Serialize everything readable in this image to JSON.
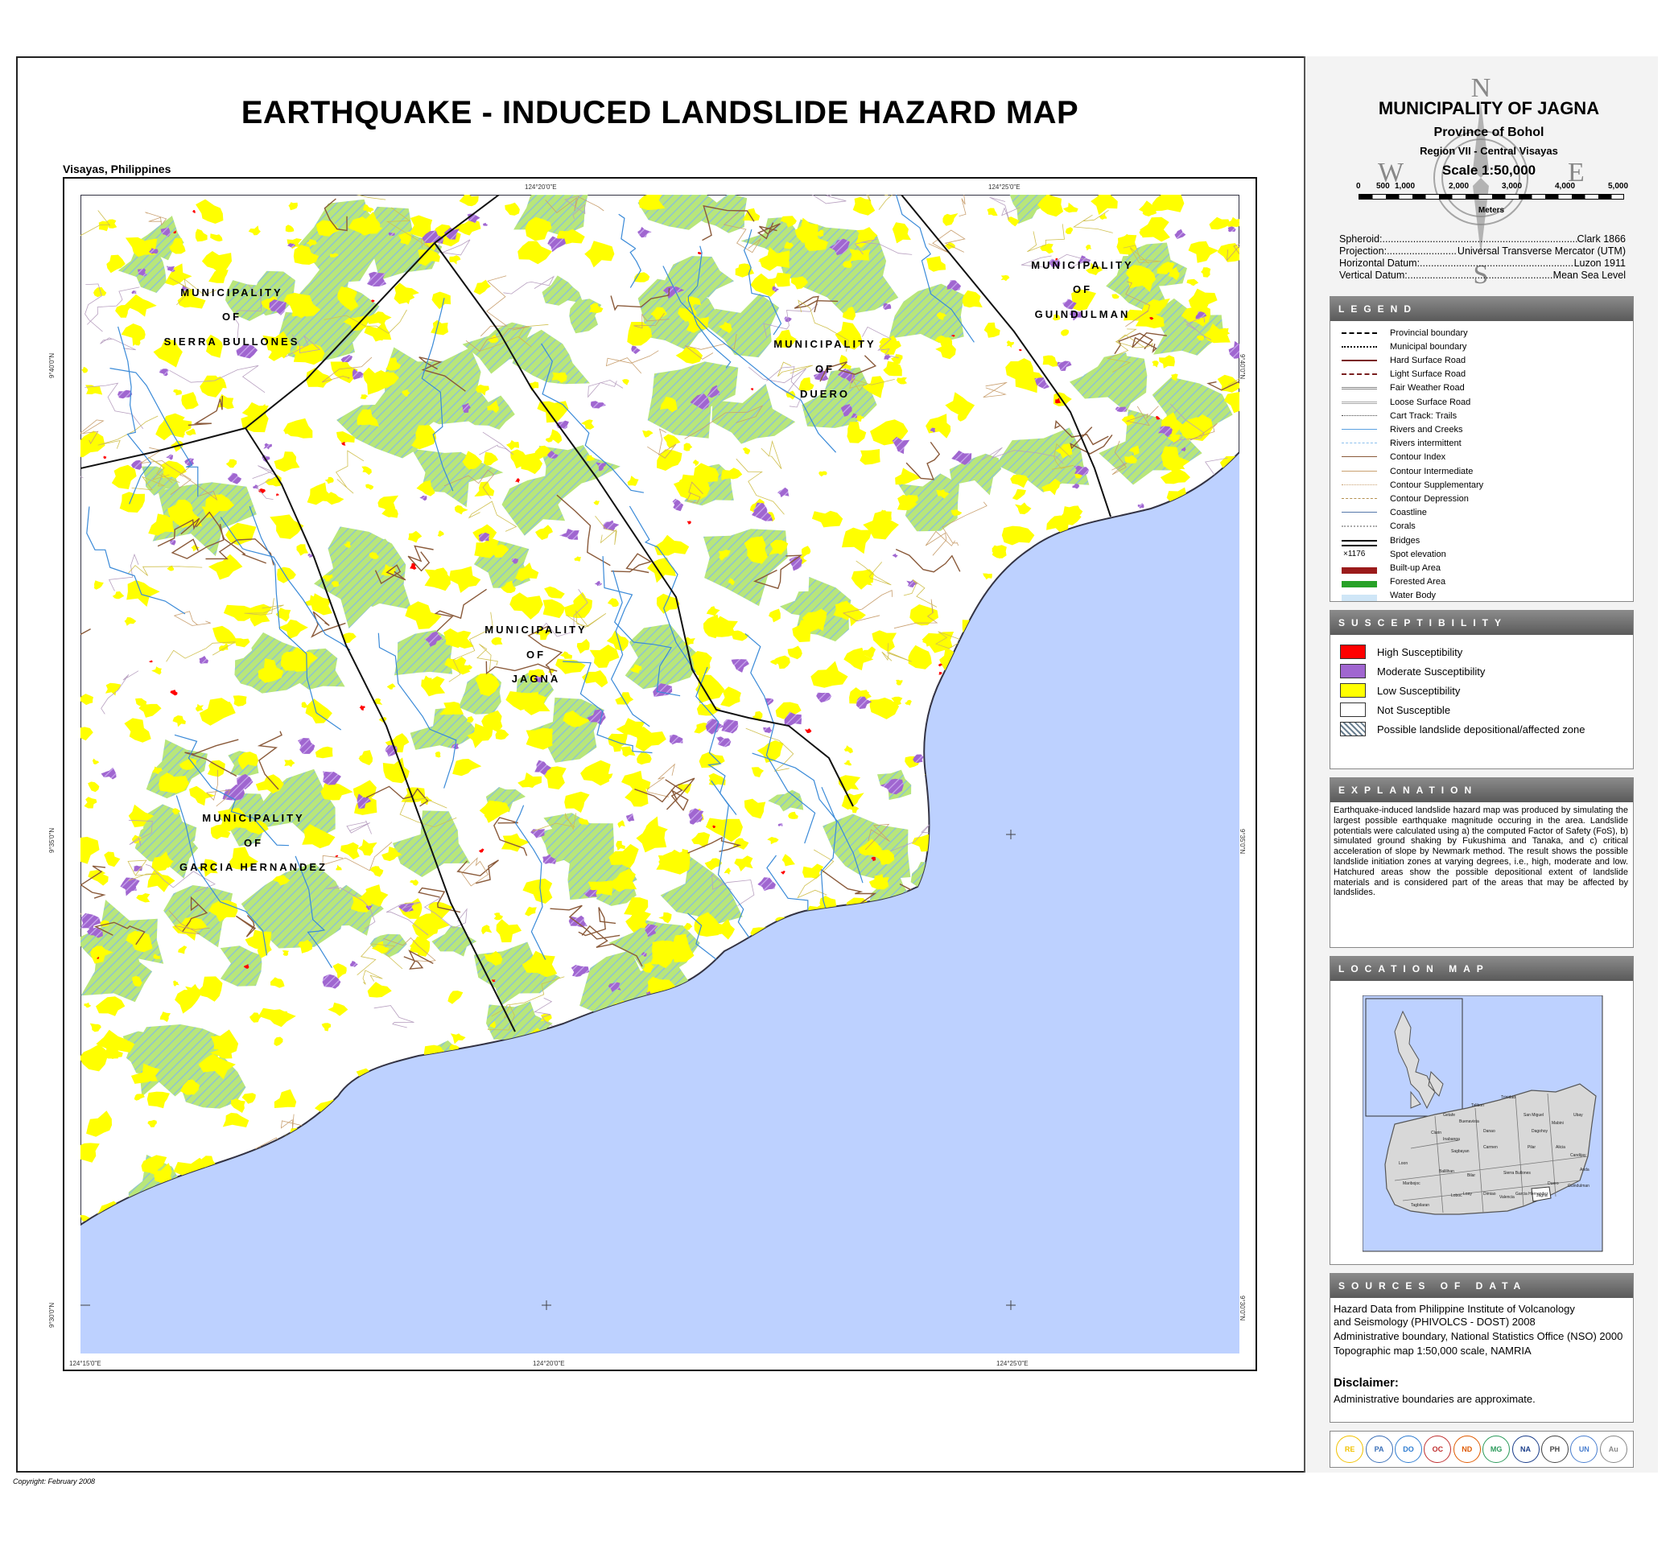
{
  "title": "EARTHQUAKE - INDUCED LANDSLIDE  HAZARD MAP",
  "subtitle": "Visayas, Philippines",
  "copyright": "Copyright: February 2008",
  "colors": {
    "high": "#ff0000",
    "moderate": "#a066d0",
    "low": "#ffff00",
    "not_susceptible": "#ffffff",
    "sea": "#bdd1ff",
    "affected": "#b8e67a"
  },
  "map": {
    "ticks": {
      "top": [
        "124°20'0\"E",
        "124°25'0\"E"
      ],
      "bottom": [
        "124°15'0\"E",
        "124°20'0\"E",
        "124°25'0\"E"
      ],
      "left": [
        "9°40'0\"N",
        "9°35'0\"N",
        "9°30'0\"N"
      ],
      "right": [
        "9°40'0\"N",
        "9°35'0\"N",
        "9°30'0\"N"
      ]
    },
    "labels": {
      "sierra": [
        "MUNICIPALITY",
        "OF",
        "SIERRA  BULLONES"
      ],
      "duero": [
        "MUNICIPALITY",
        "OF",
        "DUERO"
      ],
      "guindulman": [
        "MUNICIPALITY",
        "OF",
        "GUINDULMAN"
      ],
      "jagna": [
        "MUNICIPALITY",
        "OF",
        "JAGNA"
      ],
      "garcia": [
        "MUNICIPALITY",
        "OF",
        "GARCIA HERNANDEZ"
      ]
    }
  },
  "sidebar": {
    "municipality": "MUNICIPALITY OF JAGNA",
    "province": "Province of Bohol",
    "region": "Region VII - Central Visayas",
    "scale": "Scale 1:50,000",
    "scale_ticks": [
      "0",
      "500",
      "1,000",
      "2,000",
      "3,000",
      "4,000",
      "5,000"
    ],
    "scale_unit": "Meters",
    "compass": {
      "n": "N",
      "s": "S",
      "e": "E",
      "w": "W"
    },
    "projection": [
      {
        "key": "Spheroid:",
        "value": "Clark 1866"
      },
      {
        "key": "Projection:",
        "value": "Universal Transverse Mercator (UTM)"
      },
      {
        "key": "Horizontal Datum:",
        "value": "Luzon 1911"
      },
      {
        "key": "Vertical Datum:",
        "value": "Mean Sea Level"
      }
    ],
    "legend_title": "LEGEND",
    "legend": [
      "Provincial boundary",
      "Municipal boundary",
      "Hard Surface Road",
      "Light Surface Road",
      "Fair Weather Road",
      "Loose Surface Road",
      "Cart Track: Trails",
      "Rivers and Creeks",
      "Rivers intermittent",
      "Contour Index",
      "Contour Intermediate",
      "Contour Supplementary",
      "Contour Depression",
      "Coastline",
      "Corals",
      "Bridges",
      "Spot elevation",
      "Built-up Area",
      "Forested Area",
      "Water Body"
    ],
    "spot_elev": "1176",
    "susceptibility_title": "SUSCEPTIBILITY",
    "susceptibility": [
      "High Susceptibility",
      "Moderate Susceptibility",
      "Low Susceptibility",
      "Not Susceptible",
      "Possible landslide depositional/affected zone"
    ],
    "explanation_title": "EXPLANATION",
    "explanation": "Earthquake-induced landslide hazard map was produced by simulating the largest possible earthquake magnitude occuring in the area. Landslide potentials were calculated using a) the computed Factor of Safety (FoS), b) simulated ground shaking by Fukushima and Tanaka, and c) critical acceleration of slope by Newmark method. The result shows the possible landslide initiation zones at varying degrees, i.e., high, moderate and low. Hatchured areas show the possible depositional extent of landslide materials and is considered part of the areas that may be affected by landslides.",
    "location_title": "LOCATION MAP",
    "location_towns": [
      "Talibon",
      "Trinidad",
      "Ubay",
      "Carmen",
      "Pilar",
      "Alicia",
      "Candijay",
      "Anda",
      "Jagna",
      "Garcia Hernandez",
      "Valencia",
      "Dimiao",
      "Loboc",
      "Loay",
      "Tagbilaran",
      "Inabanga",
      "Buenavista",
      "San Miguel",
      "Danao",
      "Sagbayan",
      "Balilihan",
      "Bilar",
      "Sierra Bullones",
      "Duero",
      "Guindulman",
      "Mabini",
      "Dagohoy",
      "Getafe",
      "Clarin",
      "Loon",
      "Maribojoc"
    ],
    "sources_title": "SOURCES OF DATA",
    "sources": [
      "Hazard Data from Philippine Institute of Volcanology",
      "and Seismology (PHIVOLCS - DOST) 2008",
      "Administrative boundary, National Statistics Office (NSO) 2000",
      "Topographic map 1:50,000 scale,  NAMRIA"
    ],
    "disclaimer_title": "Disclaimer:",
    "disclaimer": "Administrative boundaries are approximate.",
    "logos": [
      "READY",
      "PAGASA",
      "DOST",
      "OCD",
      "NDCC",
      "MGB",
      "NAMRIA",
      "PHIV",
      "UNDP",
      "AusAID"
    ]
  }
}
